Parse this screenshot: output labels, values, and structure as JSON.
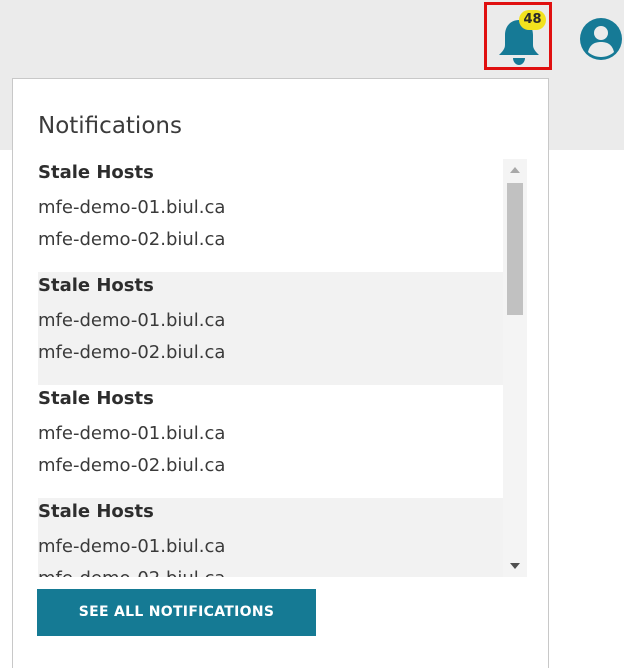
{
  "header": {
    "notification_count": "48",
    "highlight_color": "#e01010",
    "bell_color": "#167a96",
    "badge_color": "#f2e21e"
  },
  "notifications": {
    "title": "Notifications",
    "items": [
      {
        "title": "Stale Hosts",
        "hosts": [
          "mfe-demo-01.biul.ca",
          "mfe-demo-02.biul.ca"
        ]
      },
      {
        "title": "Stale Hosts",
        "hosts": [
          "mfe-demo-01.biul.ca",
          "mfe-demo-02.biul.ca"
        ]
      },
      {
        "title": "Stale Hosts",
        "hosts": [
          "mfe-demo-01.biul.ca",
          "mfe-demo-02.biul.ca"
        ]
      },
      {
        "title": "Stale Hosts",
        "hosts": [
          "mfe-demo-01.biul.ca",
          "mfe-demo-02.biul.ca"
        ]
      }
    ],
    "see_all_label": "SEE ALL NOTIFICATIONS",
    "button_color": "#157a94"
  },
  "icons": {
    "bell": "bell-icon",
    "user": "user-circle-icon",
    "scroll_up": "scroll-up-arrow-icon",
    "scroll_down": "scroll-down-arrow-icon"
  }
}
